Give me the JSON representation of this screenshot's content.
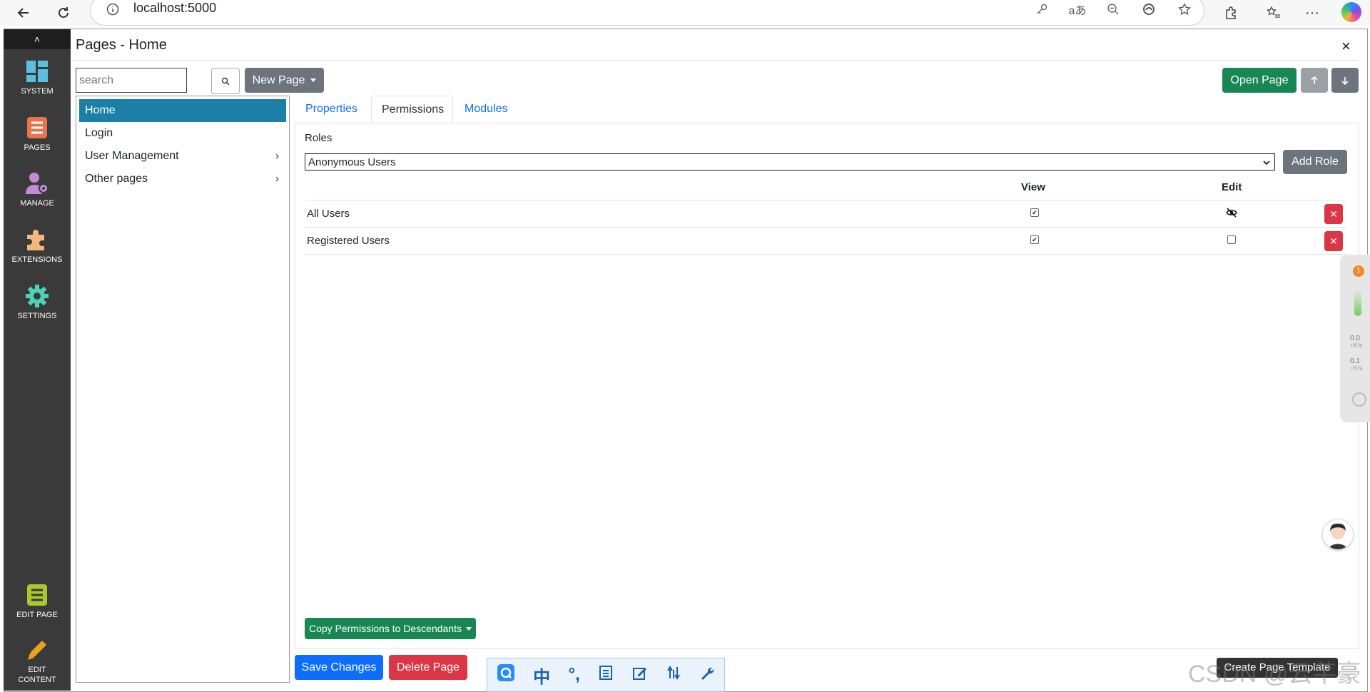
{
  "browser": {
    "url": "localhost:5000"
  },
  "sidebar": {
    "items": [
      {
        "label": "SYSTEM",
        "icon": "dashboard-icon"
      },
      {
        "label": "PAGES",
        "icon": "pages-icon"
      },
      {
        "label": "MANAGE",
        "icon": "manage-users-icon"
      },
      {
        "label": "EXTENSIONS",
        "icon": "puzzle-icon"
      },
      {
        "label": "SETTINGS",
        "icon": "gear-icon"
      }
    ],
    "bottom_items": [
      {
        "label": "EDIT PAGE",
        "icon": "edit-page-icon"
      },
      {
        "label_line1": "EDIT",
        "label_line2": "CONTENT",
        "icon": "pencil-icon"
      }
    ],
    "collapse_glyph": "˄"
  },
  "header": {
    "title": "Pages - Home",
    "close_glyph": "×"
  },
  "toolbar": {
    "search_placeholder": "search",
    "new_page_label": "New Page",
    "open_page_label": "Open Page"
  },
  "tree": {
    "items": [
      {
        "label": "Home",
        "active": true,
        "has_children": false
      },
      {
        "label": "Login",
        "active": false,
        "has_children": false
      },
      {
        "label": "User Management",
        "active": false,
        "has_children": true
      },
      {
        "label": "Other pages",
        "active": false,
        "has_children": true
      }
    ]
  },
  "tabs": [
    {
      "label": "Properties",
      "active": false
    },
    {
      "label": "Permissions",
      "active": true
    },
    {
      "label": "Modules",
      "active": false
    }
  ],
  "permissions": {
    "roles_label": "Roles",
    "selected_role": "Anonymous Users",
    "add_role_label": "Add Role",
    "columns": {
      "view": "View",
      "edit": "Edit"
    },
    "rows": [
      {
        "role": "All Users",
        "view": true,
        "edit": "hidden"
      },
      {
        "role": "Registered Users",
        "view": true,
        "edit": false
      }
    ],
    "copy_label": "Copy Permissions to Descendants"
  },
  "footer": {
    "save_label": "Save Changes",
    "delete_label": "Delete Page",
    "template_label": "Create Page Template"
  },
  "overlay": {
    "watermark": "CSDN @云芊豪",
    "net_up": "0.0",
    "net_down": "0.1",
    "net_unit": "K/s",
    "badge": "1"
  },
  "colors": {
    "sidebar_bg": "#3a3a3a",
    "active_tree": "#1b7fa8",
    "success": "#198754",
    "primary": "#0d6efd",
    "danger": "#dc3545",
    "secondary": "#6c757d"
  }
}
